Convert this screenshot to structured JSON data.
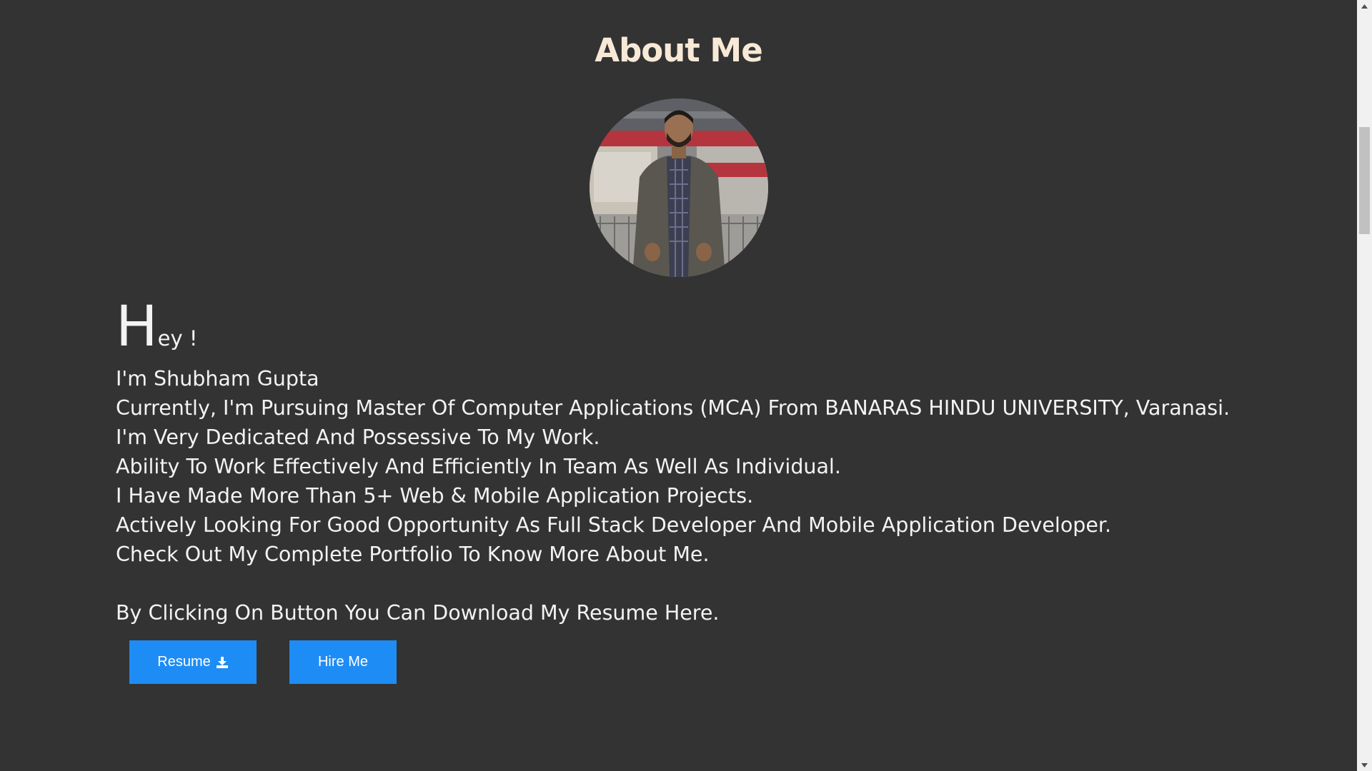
{
  "section": {
    "title": "About Me"
  },
  "profile": {
    "greeting_big": "H",
    "greeting_small": "ey !",
    "lines": [
      "I'm Shubham Gupta",
      "Currently, I'm Pursuing Master Of Computer Applications (MCA) From BANARAS HINDU UNIVERSITY, Varanasi.",
      "I'm Very Dedicated And Possessive To My Work.",
      "Ability To Work Effectively And Efficiently In Team As Well As Individual.",
      "I Have Made More Than 5+ Web & Mobile Application Projects.",
      "Actively Looking For Good Opportunity As Full Stack Developer And Mobile Application Developer.",
      "Check Out My Complete Portfolio To Know More About Me."
    ],
    "resume_note": "By Clicking On Button You Can Download My Resume Here."
  },
  "buttons": {
    "resume_label": "Resume",
    "resume_icon": "download-icon",
    "hire_label": "Hire Me"
  },
  "colors": {
    "background": "#333333",
    "title": "#f8e9d7",
    "text": "#f3f3f3",
    "button": "#1e8cf5"
  }
}
